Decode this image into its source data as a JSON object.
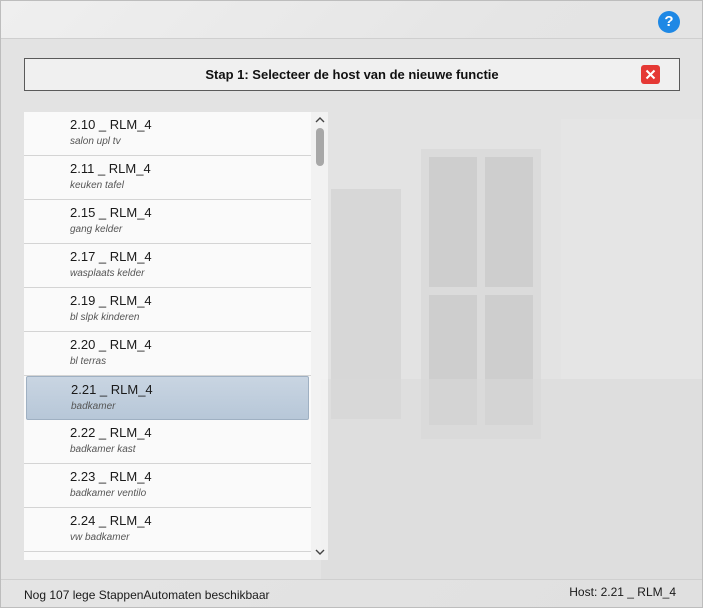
{
  "header": {
    "help_icon": "help-icon",
    "help_label": "?"
  },
  "step": {
    "title": "Stap 1: Selecteer de host van de nieuwe functie",
    "close_icon": "close-icon"
  },
  "list": {
    "selected_index": 6,
    "items": [
      {
        "name": "2.10 _ RLM_4",
        "desc": "salon upl tv"
      },
      {
        "name": "2.11 _ RLM_4",
        "desc": "keuken tafel"
      },
      {
        "name": "2.15 _ RLM_4",
        "desc": "gang kelder"
      },
      {
        "name": "2.17 _ RLM_4",
        "desc": "wasplaats kelder"
      },
      {
        "name": "2.19 _ RLM_4",
        "desc": "bl slpk kinderen"
      },
      {
        "name": "2.20 _ RLM_4",
        "desc": "bl terras"
      },
      {
        "name": "2.21 _ RLM_4",
        "desc": "badkamer"
      },
      {
        "name": "2.22 _ RLM_4",
        "desc": "badkamer kast"
      },
      {
        "name": "2.23 _ RLM_4",
        "desc": "badkamer ventilo"
      },
      {
        "name": "2.24 _ RLM_4",
        "desc": "vw badkamer"
      }
    ],
    "scroll_up_icon": "chevron-up-icon",
    "scroll_down_icon": "chevron-down-icon"
  },
  "footer": {
    "status": "Nog 107 lege StappenAutomaten beschikbaar",
    "host": "Host: 2.21 _ RLM_4"
  },
  "colors": {
    "help": "#1e88e5",
    "close": "#e53935",
    "selected": "#bfcddc"
  }
}
